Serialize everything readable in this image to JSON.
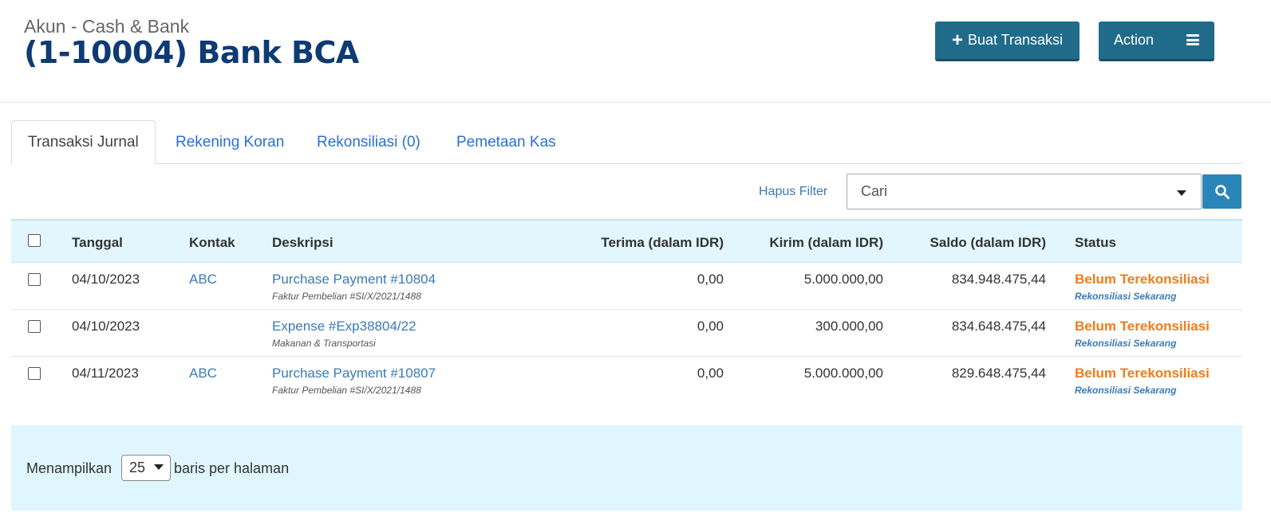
{
  "header": {
    "subtitle": "Akun - Cash & Bank",
    "title": "(1-10004) Bank BCA",
    "create_button_label": "Buat Transaksi",
    "action_button_label": "Action"
  },
  "tabs": [
    {
      "label": "Transaksi Jurnal",
      "active": true
    },
    {
      "label": "Rekening Koran",
      "active": false
    },
    {
      "label": "Rekonsiliasi (0)",
      "active": false
    },
    {
      "label": "Pemetaan Kas",
      "active": false
    }
  ],
  "filter": {
    "clear_label": "Hapus Filter",
    "search_placeholder": "Cari"
  },
  "table": {
    "columns": [
      "Tanggal",
      "Kontak",
      "Deskripsi",
      "Terima (dalam IDR)",
      "Kirim (dalam IDR)",
      "Saldo (dalam IDR)",
      "Status"
    ],
    "rows": [
      {
        "date": "04/10/2023",
        "contact": "ABC",
        "description": "Purchase Payment #10804",
        "description_sub": "Faktur Pembelian #SI/X/2021/1488",
        "received": "0,00",
        "sent": "5.000.000,00",
        "balance": "834.948.475,44",
        "status": "Belum Terekonsiliasi",
        "status_action": "Rekonsiliasi Sekarang"
      },
      {
        "date": "04/10/2023",
        "contact": "",
        "description": "Expense #Exp38804/22",
        "description_sub": "Makanan & Transportasi",
        "received": "0,00",
        "sent": "300.000,00",
        "balance": "834.648.475,44",
        "status": "Belum Terekonsiliasi",
        "status_action": "Rekonsiliasi Sekarang"
      },
      {
        "date": "04/11/2023",
        "contact": "ABC",
        "description": "Purchase Payment #10807",
        "description_sub": "Faktur Pembelian #SI/X/2021/1488",
        "received": "0,00",
        "sent": "5.000.000,00",
        "balance": "829.648.475,44",
        "status": "Belum Terekonsiliasi",
        "status_action": "Rekonsiliasi Sekarang"
      }
    ]
  },
  "pagination": {
    "prefix": "Menampilkan",
    "per_page": "25",
    "suffix": "baris per halaman"
  },
  "colors": {
    "primary_button": "#216b8a",
    "title": "#0d3b74",
    "link": "#3a7ab8",
    "status_warning": "#f07c1c",
    "table_header_bg": "#e3f6fd"
  },
  "icons": {
    "create": "plus-icon",
    "action": "hamburger-menu-icon",
    "search": "search-icon",
    "dropdown": "caret-down-icon"
  }
}
